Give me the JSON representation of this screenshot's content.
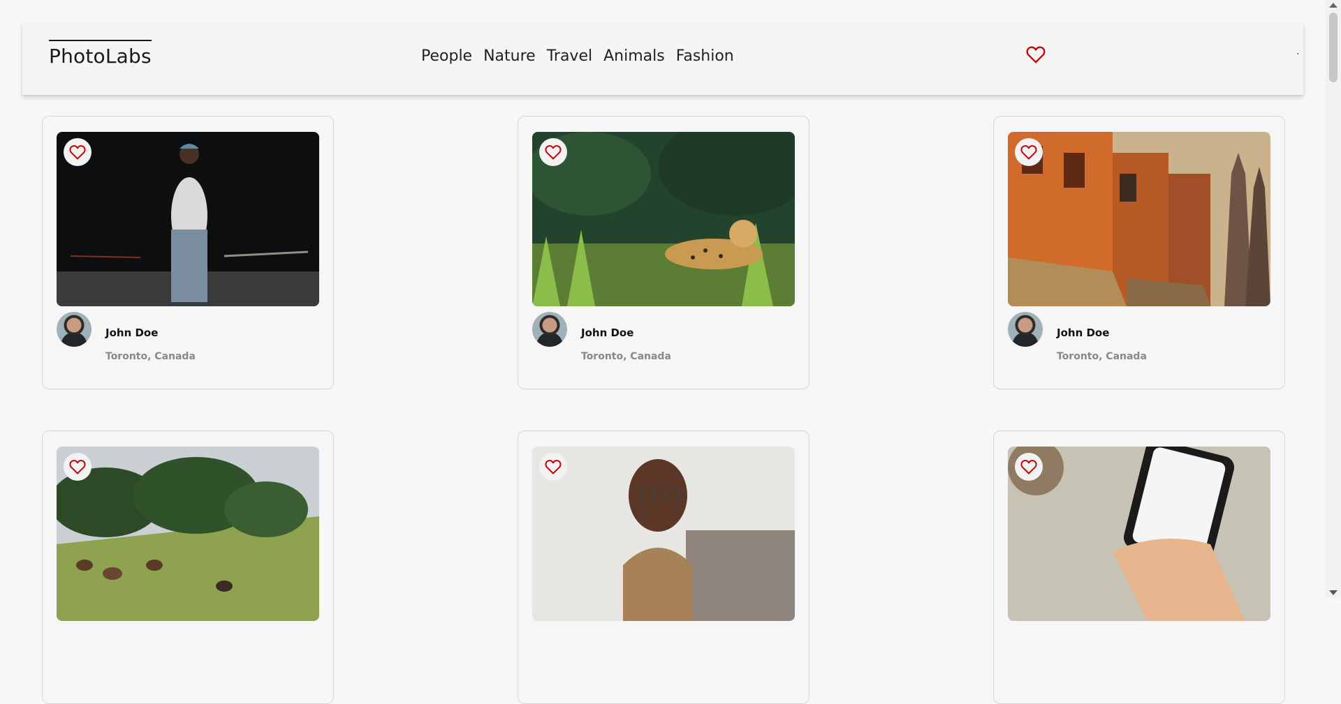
{
  "brand": "PhotoLabs",
  "topics": [
    "People",
    "Nature",
    "Travel",
    "Animals",
    "Fashion"
  ],
  "nav_indicator": ".",
  "accent_color": "#c80000",
  "icons": {
    "favorite": "heart-outline-icon"
  },
  "photos": [
    {
      "user": "John Doe",
      "location": "Toronto, Canada",
      "subject": "person"
    },
    {
      "user": "John Doe",
      "location": "Toronto, Canada",
      "subject": "jaguar"
    },
    {
      "user": "John Doe",
      "location": "Toronto, Canada",
      "subject": "street"
    },
    {
      "user": "",
      "location": "",
      "subject": "horses"
    },
    {
      "user": "",
      "location": "",
      "subject": "smiling-man"
    },
    {
      "user": "",
      "location": "",
      "subject": "phone"
    }
  ]
}
